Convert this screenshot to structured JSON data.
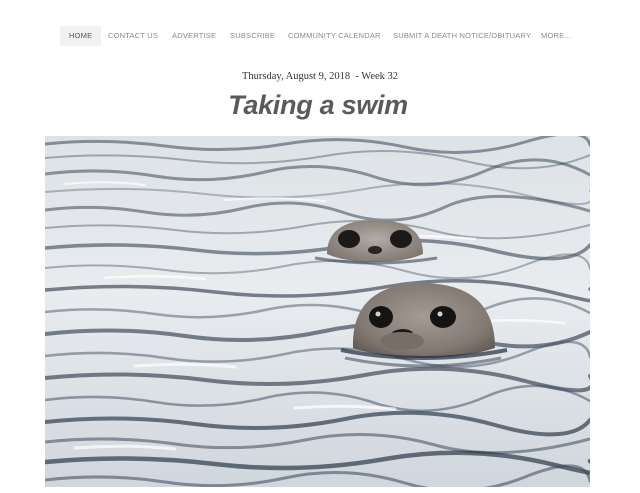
{
  "nav": {
    "items": [
      {
        "label": "HOME",
        "active": true
      },
      {
        "label": "CONTACT US"
      },
      {
        "label": "ADVERTISE"
      },
      {
        "label": "SUBSCRIBE"
      },
      {
        "label": "COMMUNITY CALENDAR"
      },
      {
        "label": "SUBMIT A DEATH NOTICE/OBITUARY"
      },
      {
        "label": "MORE..."
      }
    ]
  },
  "article": {
    "date_line": "Thursday, August 9, 2018  - Week 32",
    "title": "Taking a swim"
  },
  "photo": {
    "subject": "two harbor seals swimming, heads above rippled water",
    "colors": {
      "water_light": "#e4e8ec",
      "water_dark": "#2c3a4a",
      "seal": "#8d8680"
    }
  }
}
